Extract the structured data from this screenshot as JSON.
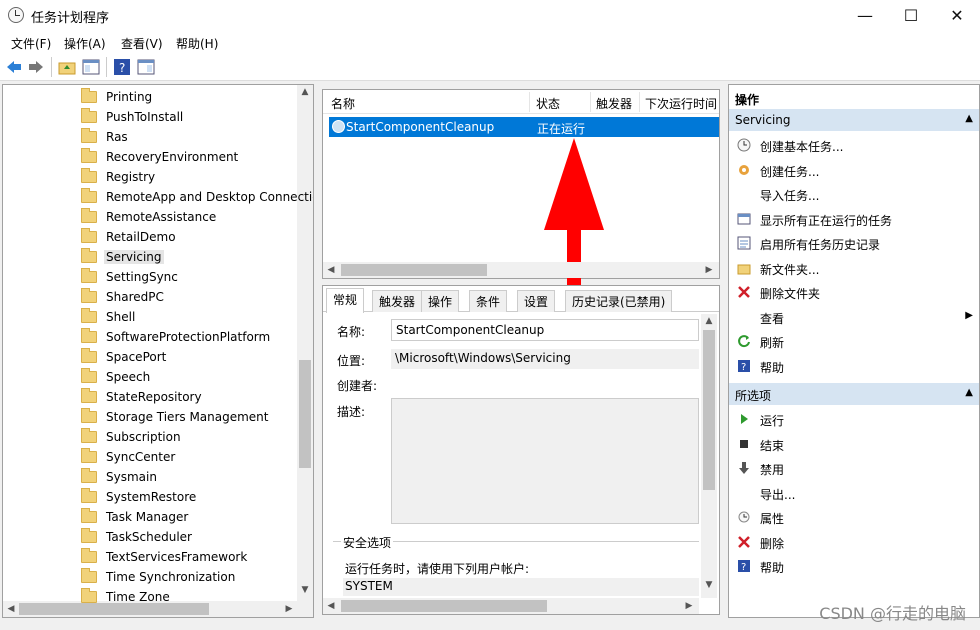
{
  "window": {
    "title": "任务计划程序",
    "minimize": "—",
    "maximize": "☐",
    "close": "✕"
  },
  "menu": [
    "文件(F)",
    "操作(A)",
    "查看(V)",
    "帮助(H)"
  ],
  "toolbar": {
    "icons": [
      "back-arrow-icon",
      "forward-arrow-icon",
      "folder-up-icon",
      "show-hide-tree-icon",
      "help-icon",
      "properties-icon"
    ]
  },
  "tree": {
    "items": [
      "Printing",
      "PushToInstall",
      "Ras",
      "RecoveryEnvironment",
      "Registry",
      "RemoteApp and Desktop Connections",
      "RemoteAssistance",
      "RetailDemo",
      "Servicing",
      "SettingSync",
      "SharedPC",
      "Shell",
      "SoftwareProtectionPlatform",
      "SpacePort",
      "Speech",
      "StateRepository",
      "Storage Tiers Management",
      "Subscription",
      "SyncCenter",
      "Sysmain",
      "SystemRestore",
      "Task Manager",
      "TaskScheduler",
      "TextServicesFramework",
      "Time Synchronization",
      "Time Zone"
    ],
    "selected": "Servicing"
  },
  "list": {
    "columns": [
      "名称",
      "状态",
      "触发器",
      "下次运行时间"
    ],
    "rows": [
      {
        "name": "StartComponentCleanup",
        "status": "正在运行"
      }
    ]
  },
  "detail": {
    "tabs": [
      "常规",
      "触发器",
      "操作",
      "条件",
      "设置",
      "历史记录(已禁用)"
    ],
    "name_label": "名称:",
    "name_value": "StartComponentCleanup",
    "location_label": "位置:",
    "location_value": "\\Microsoft\\Windows\\Servicing",
    "author_label": "创建者:",
    "description_label": "描述:",
    "security_title": "安全选项",
    "run_as_label": "运行任务时，请使用下列用户帐户:",
    "user_value": "SYSTEM"
  },
  "actions": {
    "header": "操作",
    "group1": "Servicing",
    "items1": [
      "创建基本任务...",
      "创建任务...",
      "导入任务...",
      "显示所有正在运行的任务",
      "启用所有任务历史记录",
      "新文件夹...",
      "删除文件夹",
      "查看",
      "刷新",
      "帮助"
    ],
    "group2": "所选项",
    "items2": [
      "运行",
      "结束",
      "禁用",
      "导出...",
      "属性",
      "删除",
      "帮助"
    ]
  },
  "watermark": "CSDN @行走的电脑",
  "colors": {
    "selection": "#0078d7",
    "group_bg": "#d6e4f2",
    "annotation_arrow": "#ff0000"
  }
}
